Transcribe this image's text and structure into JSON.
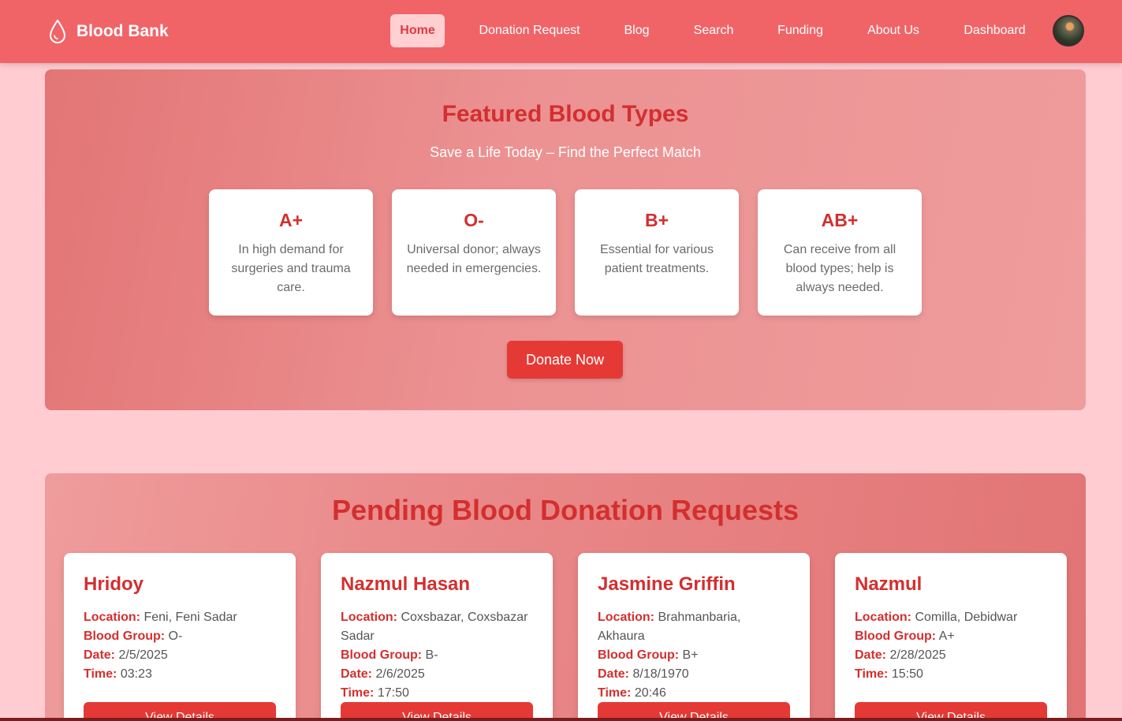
{
  "navbar": {
    "brand": "Blood Bank",
    "links": [
      {
        "label": "Home",
        "active": true
      },
      {
        "label": "Donation Request"
      },
      {
        "label": "Blog"
      },
      {
        "label": "Search"
      },
      {
        "label": "Funding"
      },
      {
        "label": "About Us"
      },
      {
        "label": "Dashboard"
      }
    ]
  },
  "featured": {
    "title": "Featured Blood Types",
    "subtitle": "Save a Life Today – Find the Perfect Match",
    "types": [
      {
        "name": "A+",
        "desc": "In high demand for surgeries and trauma care."
      },
      {
        "name": "O-",
        "desc": "Universal donor; always needed in emergencies."
      },
      {
        "name": "B+",
        "desc": "Essential for various patient treatments."
      },
      {
        "name": "AB+",
        "desc": "Can receive from all blood types; help is always needed."
      }
    ],
    "donate_label": "Donate Now"
  },
  "pending": {
    "title": "Pending Blood Donation Requests",
    "labels": {
      "location": "Location:",
      "blood_group": "Blood Group:",
      "date": "Date:",
      "time": "Time:"
    },
    "button_label": "View Details",
    "requests": [
      {
        "name": "Hridoy",
        "location": "Feni, Feni Sadar",
        "blood_group": "O-",
        "date": "2/5/2025",
        "time": "03:23"
      },
      {
        "name": "Nazmul Hasan",
        "location": "Coxsbazar, Coxsbazar Sadar",
        "blood_group": "B-",
        "date": "2/6/2025",
        "time": "17:50"
      },
      {
        "name": "Jasmine Griffin",
        "location": "Brahmanbaria, Akhaura",
        "blood_group": "B+",
        "date": "8/18/1970",
        "time": "20:46"
      },
      {
        "name": "Nazmul",
        "location": "Comilla, Debidwar",
        "blood_group": "A+",
        "date": "2/28/2025",
        "time": "15:50"
      }
    ]
  },
  "colors": {
    "navbar": "#f06468",
    "accent": "#d32f2f",
    "button": "#e53935",
    "page_bg": "#ffccd2"
  },
  "icons": {
    "brand": "blood-drop-icon",
    "avatar": "user-avatar"
  }
}
